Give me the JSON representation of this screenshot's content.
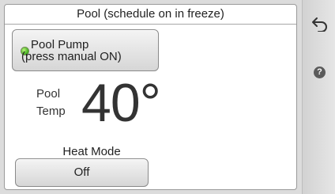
{
  "header": {
    "title": "Pool (schedule on in freeze)"
  },
  "pump_button": {
    "line1": "Pool Pump",
    "line2": "(press manual ON)",
    "led_color": "#3fae1c"
  },
  "temperature": {
    "label_line1": "Pool",
    "label_line2": "Temp",
    "value": "40°"
  },
  "heat_mode": {
    "label": "Heat Mode",
    "button_label": "Off"
  },
  "sidebar": {
    "icons": [
      "back-arrow-icon",
      "help-icon"
    ],
    "help_glyph": "?"
  }
}
